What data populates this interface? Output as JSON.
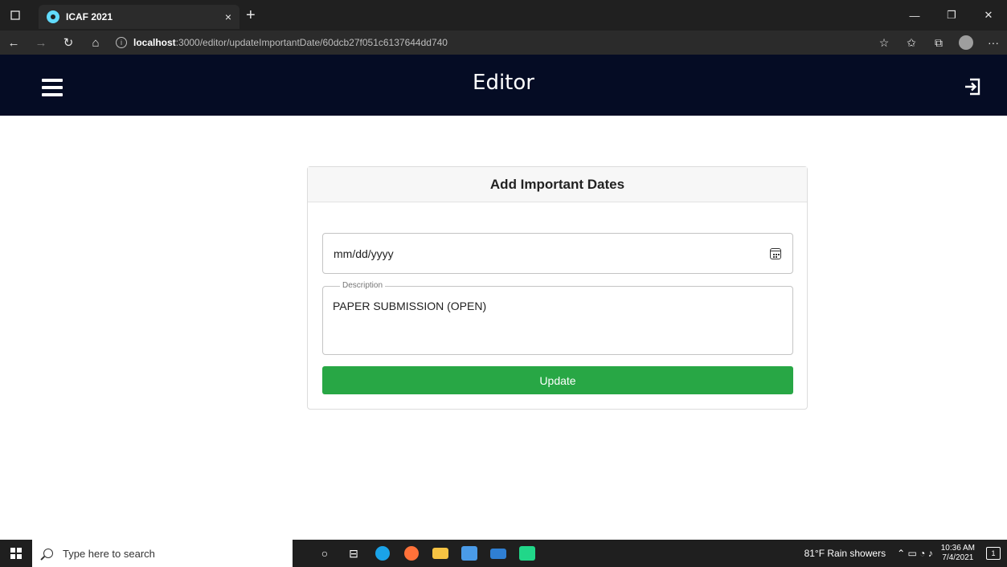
{
  "browser": {
    "tab_title": "ICAF 2021",
    "tab_close": "×",
    "new_tab": "+",
    "url_host": "localhost",
    "url_path": ":3000/editor/updateImportantDate/60dcb27f051c6137644dd740",
    "window_controls": {
      "minimize": "—",
      "restore": "❐",
      "close": "✕"
    }
  },
  "app": {
    "title": "Editor"
  },
  "form": {
    "header": "Add Important Dates",
    "date_placeholder": "mm/dd/yyyy",
    "description_label": "Description",
    "description_value": "PAPER SUBMISSION (OPEN)",
    "submit_label": "Update"
  },
  "taskbar": {
    "search_placeholder": "Type here to search",
    "weather": "81°F  Rain showers",
    "time": "10:36 AM",
    "date": "7/4/2021",
    "notification_count": "1"
  },
  "colors": {
    "header_bg": "#050c24",
    "button_bg": "#28a745"
  }
}
